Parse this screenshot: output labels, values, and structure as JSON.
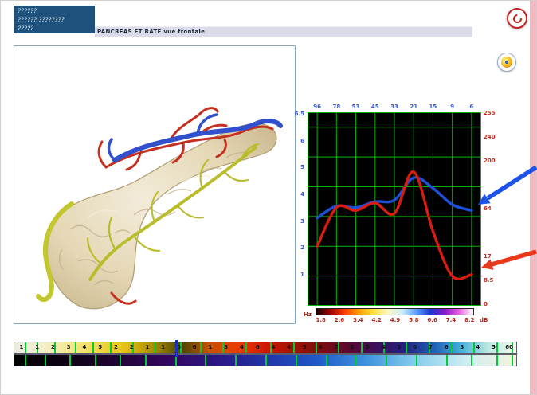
{
  "header": {
    "box_lines": [
      "??????",
      "?????? ????????",
      "?????"
    ],
    "subtitle": "PANCREAS ET RATE vue frontale"
  },
  "chart_data": {
    "type": "line",
    "x": [
      1.8,
      2.6,
      3.4,
      4.2,
      4.9,
      5.8,
      6.6,
      7.4,
      8.2
    ],
    "series": [
      {
        "name": "blue-curve",
        "color": "#1d4fd8",
        "values": [
          2.95,
          3.35,
          3.3,
          3.5,
          3.55,
          4.3,
          3.95,
          3.4,
          3.2
        ]
      },
      {
        "name": "red-curve",
        "color": "#d61d10",
        "values": [
          2.0,
          3.3,
          3.2,
          3.45,
          3.1,
          4.5,
          2.5,
          1.0,
          1.05
        ]
      }
    ],
    "ylim": [
      0,
      6.5
    ],
    "grid": true,
    "plot_bg": "#000000",
    "grid_color": "#00b400",
    "top_axis": [
      "96",
      "78",
      "53",
      "45",
      "33",
      "21",
      "15",
      "9",
      "6"
    ],
    "left_axis": [
      "6.5",
      "6",
      "5",
      "4",
      "3",
      "2",
      "1"
    ],
    "right_axis": [
      "255",
      "240",
      "200",
      "",
      "64",
      "",
      "17",
      "8.5",
      "0"
    ],
    "bottom_axis": [
      "1.8",
      "2.6",
      "3.4",
      "4.2",
      "4.9",
      "5.8",
      "6.6",
      "7.4",
      "8.2"
    ],
    "hz_label": "Hz",
    "db_label": "dB",
    "colorbar": [
      "#140000",
      "#a00000",
      "#ff3c00",
      "#ff9e00",
      "#ffe13c",
      "#fdf7c0",
      "#cfeffa",
      "#5aa0ff",
      "#1a35cf",
      "#8818c8",
      "#e660e0",
      "#ffffff"
    ]
  },
  "bottom_bars": {
    "bar1_numbers": [
      "1",
      "1",
      "2",
      "3",
      "4",
      "5",
      "2",
      "2",
      "1",
      "1",
      "5",
      "6",
      "1",
      "3",
      "4",
      "6",
      "4",
      "4",
      "5",
      "6",
      "7",
      "8",
      "5",
      "4",
      "5",
      "6",
      "7",
      "6",
      "3",
      "4",
      "5",
      "60"
    ],
    "bar1_colors": [
      "#eceadf",
      "#f3efcb",
      "#f5e98e",
      "#f0d94a",
      "#e3c112",
      "#a88c00",
      "#4a4600",
      "#c85200",
      "#ea3c00",
      "#d01800",
      "#a01300",
      "#7c0d10",
      "#5c0830",
      "#3a0f5c",
      "#23207e",
      "#1e5cb4",
      "#3fb0d8",
      "#bfe8e0",
      "#f2fbef"
    ],
    "bar2_colors": [
      "#020202",
      "#0d0113",
      "#1e0333",
      "#32055c",
      "#2c1582",
      "#2333a5",
      "#2058c8",
      "#3c93dc",
      "#86ceee",
      "#cfeef2",
      "#f6f3dc"
    ],
    "bar1_ticks": [
      2,
      4.5,
      8,
      12,
      15.5,
      19,
      23.5,
      28,
      33,
      37,
      41.5,
      46,
      51,
      55.5,
      60,
      64.5,
      69,
      73.5,
      78,
      82.5,
      87,
      91.5,
      96,
      99
    ],
    "bar2_ticks": [
      2,
      6,
      11,
      16,
      21,
      26,
      32,
      38,
      44,
      50,
      56,
      62,
      68,
      74,
      80,
      86,
      91,
      96,
      99
    ],
    "tick_color": "#00cc33",
    "cursor_pos": 32,
    "cursor_color": "#1b2fc0"
  },
  "annotations": {
    "blue_arrow_color": "#1d53e8",
    "red_arrow_color": "#e8391d"
  }
}
